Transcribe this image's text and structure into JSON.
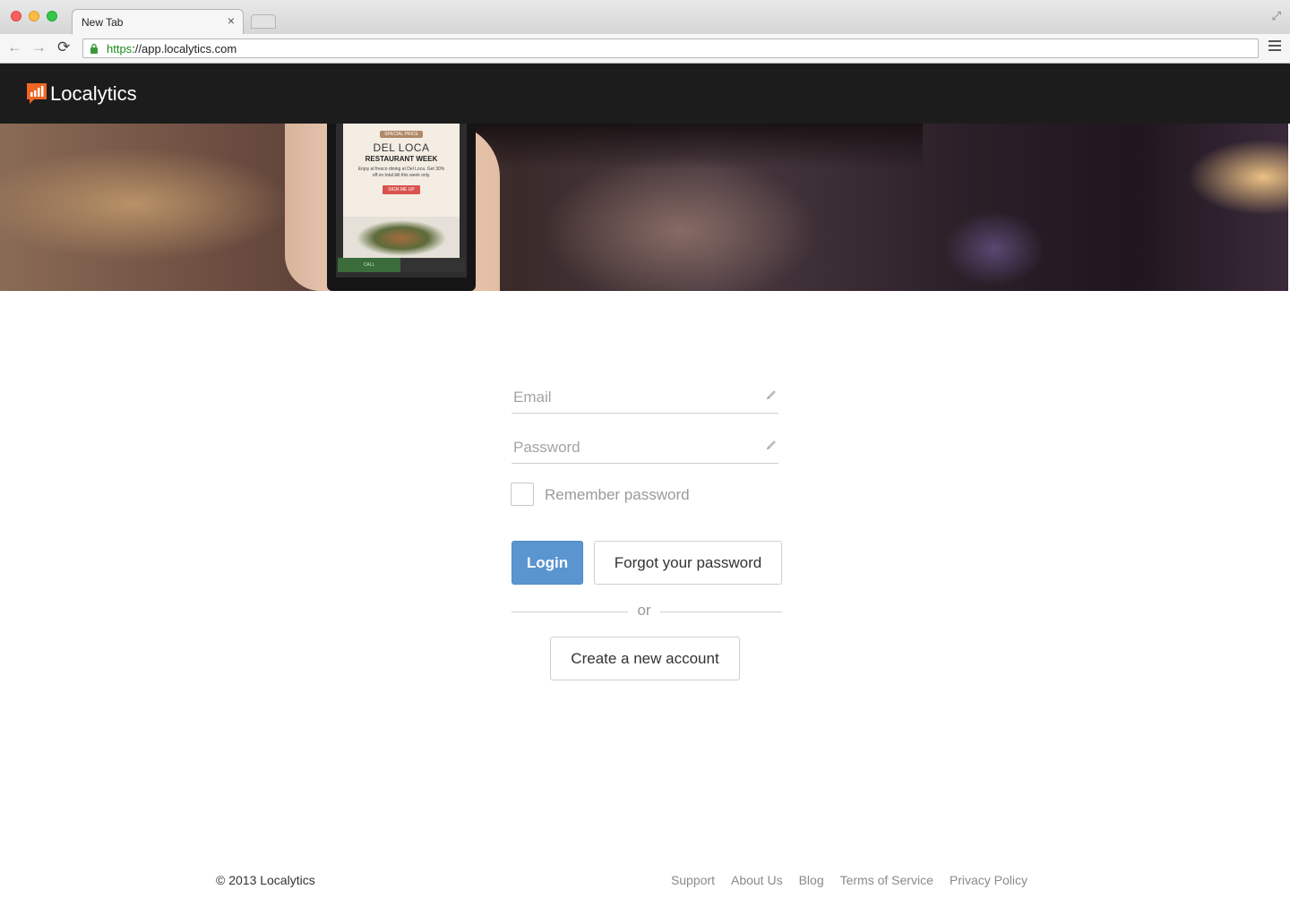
{
  "browser": {
    "tab_title": "New Tab",
    "tab_close": "×",
    "url_scheme": "https",
    "url_rest": "://app.localytics.com",
    "back_icon": "arrow-left-icon",
    "forward_icon": "arrow-right-icon",
    "reload_icon": "reload-icon",
    "menu_icon": "hamburger-menu-icon",
    "lock_color": "#3a9a3a"
  },
  "header": {
    "logo_text": "Localytics",
    "brand_color": "#f26522",
    "background": "#1c1c1c"
  },
  "hero": {
    "ad_badge": "SPECIAL PRICE",
    "ad_brand": "DEL LOCA",
    "ad_headline": "RESTAURANT WEEK",
    "ad_body": "Enjoy al fresco dining at Del Loca. Get 30% off on total bill this week only.",
    "ad_cta": "SIGN ME UP",
    "phone_call": "CALL"
  },
  "login": {
    "email_placeholder": "Email",
    "email_value": "",
    "password_placeholder": "Password",
    "password_value": "",
    "remember_label": "Remember password",
    "remember_checked": false,
    "login_label": "Login",
    "forgot_label": "Forgot your password",
    "or_label": "or",
    "create_label": "Create a new account",
    "accent_color": "#5b95d0"
  },
  "footer": {
    "copyright": "© 2013 Localytics",
    "links": [
      "Support",
      "About Us",
      "Blog",
      "Terms of Service",
      "Privacy Policy"
    ]
  }
}
